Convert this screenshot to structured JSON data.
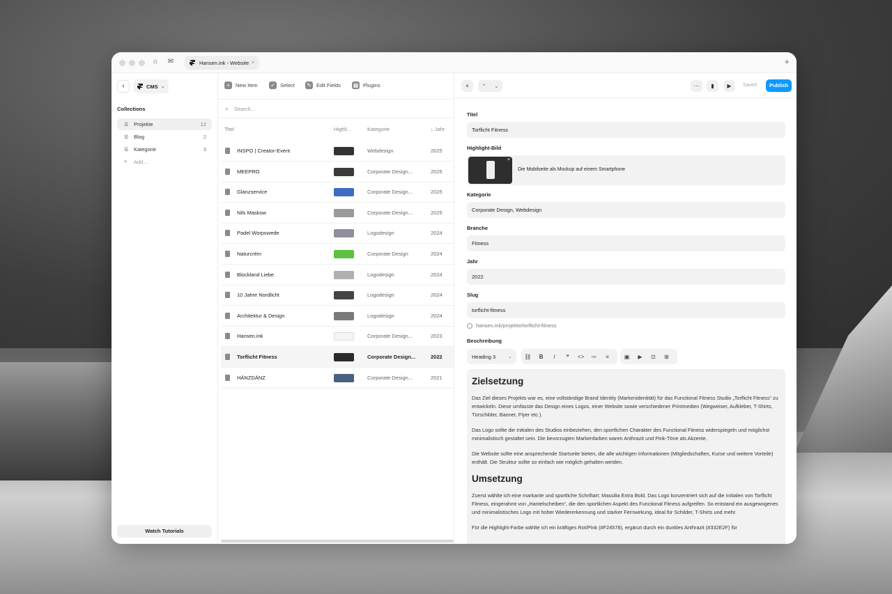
{
  "browser": {
    "tab_title": "Hansen.ink - Website",
    "close_glyph": "×",
    "new_tab_glyph": "+"
  },
  "sidebar": {
    "cms_label": "CMS",
    "collections_heading": "Collections",
    "items": [
      {
        "label": "Projekte",
        "count": "12",
        "active": true
      },
      {
        "label": "Blog",
        "count": "2",
        "active": false
      },
      {
        "label": "Kategorie",
        "count": "3",
        "active": false
      }
    ],
    "add_label": "Add...",
    "watch_tutorials": "Watch Tutorials"
  },
  "toolbar": {
    "new_item": "New Item",
    "select": "Select",
    "edit_fields": "Edit Fields",
    "plugins": "Plugins"
  },
  "list": {
    "search_placeholder": "Search...",
    "columns": {
      "titel": "Titel",
      "highlight": "Highli...",
      "kategorie": "Kategorie",
      "jahr": "Jahr"
    },
    "rows": [
      {
        "title": "INSPO | Creator-Event",
        "kategorie": "Webdesign",
        "year": "2025",
        "thumb": "#333333",
        "selected": false
      },
      {
        "title": "MEEPRO",
        "kategorie": "Corporate Design...",
        "year": "2025",
        "thumb": "#3a3a3a",
        "selected": false
      },
      {
        "title": "Glanzservice",
        "kategorie": "Corporate Design...",
        "year": "2025",
        "thumb": "#3d6cc4",
        "selected": false
      },
      {
        "title": "Nils Maskow",
        "kategorie": "Corporate Design...",
        "year": "2025",
        "thumb": "#9a9a9a",
        "selected": false
      },
      {
        "title": "Padel Worpswede",
        "kategorie": "Logodesign",
        "year": "2024",
        "thumb": "#8e8e9e",
        "selected": false
      },
      {
        "title": "Naturcrém",
        "kategorie": "Corporate Design",
        "year": "2024",
        "thumb": "#5cc13e",
        "selected": false
      },
      {
        "title": "Blockland Liebe",
        "kategorie": "Logodesign",
        "year": "2024",
        "thumb": "#b0b0b0",
        "selected": false
      },
      {
        "title": "10 Jahre Nordlicht",
        "kategorie": "Logodesign",
        "year": "2024",
        "thumb": "#444444",
        "selected": false
      },
      {
        "title": "Architektur & Design",
        "kategorie": "Logodesign",
        "year": "2024",
        "thumb": "#7a7a7a",
        "selected": false
      },
      {
        "title": "Hansen.ink",
        "kategorie": "Corporate Design...",
        "year": "2023",
        "thumb": "#f4f4f4",
        "selected": false
      },
      {
        "title": "Torflicht Fitness",
        "kategorie": "Corporate Design...",
        "year": "2022",
        "thumb": "#2a2a2a",
        "selected": true
      },
      {
        "title": "HÄNZDÄNZ",
        "kategorie": "Corporate Design...",
        "year": "2021",
        "thumb": "#4a6080",
        "selected": false
      }
    ]
  },
  "editor": {
    "saved_label": "Saved",
    "publish_label": "Publish",
    "fields": {
      "titel": {
        "label": "Titel",
        "value": "Torflicht Fitness"
      },
      "highlight": {
        "label": "Highlight-Bild",
        "caption": "Die Mobilseite als Mockup auf einem Smartphone"
      },
      "kategorie": {
        "label": "Kategorie",
        "value": "Corporate Design, Webdesign"
      },
      "branche": {
        "label": "Branche",
        "value": "Fitness"
      },
      "jahr": {
        "label": "Jahr",
        "value": "2022"
      },
      "slug": {
        "label": "Slug",
        "value": "torflicht-fitness",
        "url": "hansen.ink/projekte/torflicht-fitness"
      },
      "beschreibung": {
        "label": "Beschreibung",
        "format": "Heading 3"
      }
    },
    "content": {
      "h1": "Zielsetzung",
      "p1": "Das Ziel dieses Projekts war es, eine vollständige Brand Identity (Markenidentität) für das Functional Fitness Studio „Torflicht Fitness“ zu entwickeln. Diese umfasste das Design eines Logos, einer Website sowie verschiedener Printmedien (Wegweiser, Aufkleber, T-Shirts, Türschilder, Banner, Flyer etc.).",
      "p2": "Das Logo sollte die Initialen des Studios einbeziehen, den sportlichen Charakter des Functional Fitness widerspiegeln und möglichst minimalistisch gestaltet sein. Die bevorzugten Markenfarben waren Anthrazit und Pink-Töne als Akzente.",
      "p3": "Die Website sollte eine ansprechende Startseite bieten, die alle wichtigen Informationen (Mitgliedschaften, Kurse und weitere Vorteile) enthält. Die Struktur sollte so einfach wie möglich gehalten werden.",
      "h2": "Umsetzung",
      "p4": "Zuerst wählte ich eine markante und sportliche Schriftart: Massilia Extra Bold. Das Logo konzentriert sich auf die Initialen von Torflicht Fitness, eingerahmt von „Hantelscheiben“, die den sportlichen Aspekt des Functional Fitness aufgreifen. So entstand ein ausgewogenes und minimalistisches Logo mit hoher Wiedererkennung und starker Fernwirkung, ideal für Schilder, T-Shirts und mehr.",
      "p5": "Für die Highlight-Farbe wählte ich ein kräftiges Rot/Pink (#F24578), ergänzt durch ein dunkles Anthrazit (#332E2F) für"
    }
  },
  "colors": {
    "accent": "#0e99ff"
  }
}
